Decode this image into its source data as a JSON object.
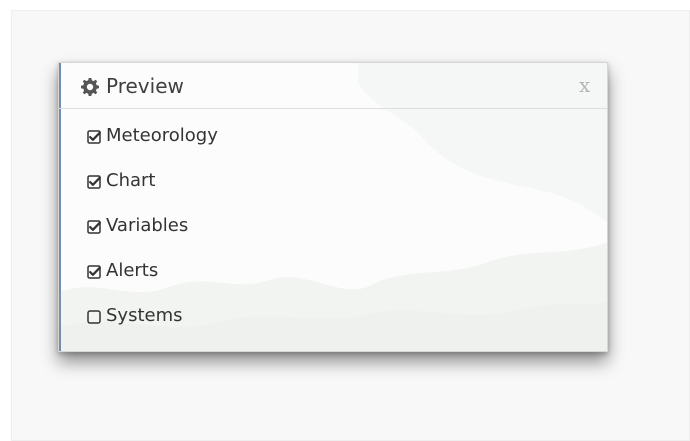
{
  "panel": {
    "title": "Preview",
    "title_icon": "gear-icon",
    "close_label": "x"
  },
  "menu": {
    "items": [
      {
        "label": "Meteorology",
        "checked": true,
        "icon": "checked-checkbox-icon"
      },
      {
        "label": "Chart",
        "checked": true,
        "icon": "checked-checkbox-icon"
      },
      {
        "label": "Variables",
        "checked": true,
        "icon": "checked-checkbox-icon"
      },
      {
        "label": "Alerts",
        "checked": true,
        "icon": "checked-checkbox-icon"
      },
      {
        "label": "Systems",
        "checked": false,
        "icon": "unchecked-checkbox-icon"
      }
    ]
  },
  "colors": {
    "text": "#333333",
    "muted": "#b5b5b5",
    "accent_edge": "#6f8fb0",
    "panel_bg": "#fcfcfc"
  }
}
